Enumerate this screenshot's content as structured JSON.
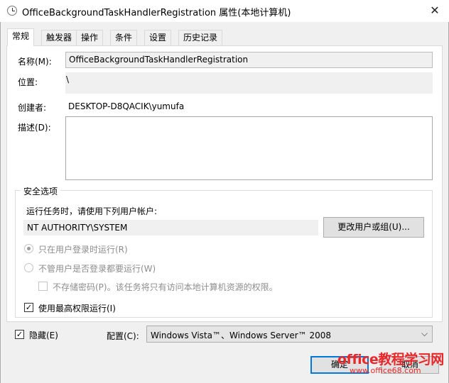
{
  "window": {
    "title": "OfficeBackgroundTaskHandlerRegistration 属性(本地计算机)",
    "close_glyph": "✕"
  },
  "tabs": [
    "常规",
    "触发器",
    "操作",
    "条件",
    "设置",
    "历史记录"
  ],
  "general": {
    "name_label": "名称(M):",
    "name_value": "OfficeBackgroundTaskHandlerRegistration",
    "location_label": "位置:",
    "location_value": "\\",
    "author_label": "创建者:",
    "author_value": "DESKTOP-D8QACIK\\yumufa",
    "description_label": "描述(D):",
    "description_value": ""
  },
  "security": {
    "group_title": "安全选项",
    "run_as_label": "运行任务时，请使用下列用户帐户:",
    "user_account": "NT AUTHORITY\\SYSTEM",
    "change_user_button": "更改用户或组(U)...",
    "radio_logged_on": "只在用户登录时运行(R)",
    "radio_whether_logged": "不管用户是否登录都要运行(W)",
    "do_not_store_password": "不存储密码(P)。该任务将只有访问本地计算机资源的权限。",
    "highest_privileges": "使用最高权限运行(I)",
    "radio_logged_on_checked": true,
    "highest_privileges_checked": true
  },
  "footer": {
    "hidden_label": "隐藏(E)",
    "hidden_checked": true,
    "configure_label": "配置(C):",
    "configure_value": "Windows Vista™、Windows Server™ 2008",
    "ok_button": "确定",
    "cancel_button": "取消"
  },
  "watermark": {
    "text": "office教程学习网",
    "url": "www.office68.com"
  },
  "icons": {
    "title_icon": "task-scheduler-clock-icon",
    "checkmark": "✓",
    "dropdown_arrow": "⌵"
  }
}
